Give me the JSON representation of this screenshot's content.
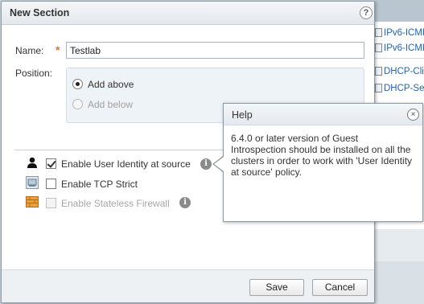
{
  "background": {
    "rows": [
      {
        "text": "IPv6-ICMP"
      },
      {
        "text": "IPv6-ICMP"
      },
      {
        "text": "DHCP-Cli"
      },
      {
        "text": "DHCP-Se"
      }
    ]
  },
  "dialog": {
    "title": "New Section",
    "help_icon": "?",
    "name_label": "Name:",
    "required_marker": "*",
    "name_value": "Testlab",
    "position_label": "Position:",
    "position_options": [
      {
        "label": "Add above",
        "selected": true,
        "enabled": true
      },
      {
        "label": "Add below",
        "selected": false,
        "enabled": false
      }
    ],
    "options": [
      {
        "icon": "user-icon",
        "label": "Enable User Identity at source",
        "checked": true,
        "enabled": true,
        "has_info": true
      },
      {
        "icon": "tcp-icon",
        "label": "Enable TCP Strict",
        "checked": false,
        "enabled": true,
        "has_info": false
      },
      {
        "icon": "firewall-icon",
        "label": "Enable Stateless Firewall",
        "checked": false,
        "enabled": false,
        "has_info": true
      }
    ],
    "info_glyph": "i",
    "save_label": "Save",
    "cancel_label": "Cancel"
  },
  "help_popup": {
    "title": "Help",
    "close_glyph": "×",
    "body": "6.4.0 or later version of Guest Introspection should be installed on all the clusters in order to work with 'User Identity at source' policy."
  },
  "colors": {
    "required": "#e07b12",
    "link": "#1f63b5",
    "position_box": "#eef3f7"
  }
}
